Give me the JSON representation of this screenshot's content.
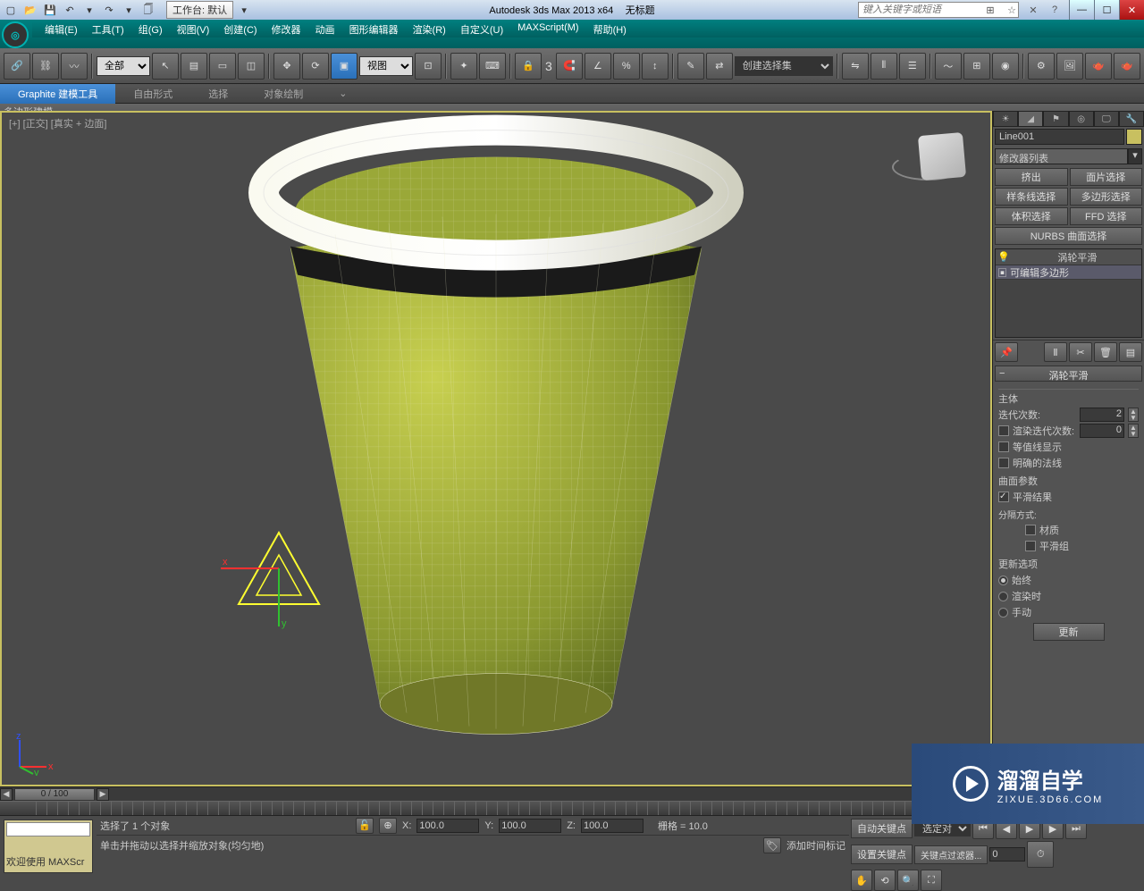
{
  "titlebar": {
    "workspace": "工作台: 默认",
    "app_title": "Autodesk 3ds Max  2013 x64",
    "doc_title": "无标题",
    "search_placeholder": "键入关键字或短语"
  },
  "menu": {
    "items": [
      "编辑(E)",
      "工具(T)",
      "组(G)",
      "视图(V)",
      "创建(C)",
      "修改器",
      "动画",
      "图形编辑器",
      "渲染(R)",
      "自定义(U)",
      "MAXScript(M)",
      "帮助(H)"
    ]
  },
  "toolbar": {
    "filter_dd": "全部",
    "view_dd": "视图",
    "three": "3",
    "named_sel": "创建选择集"
  },
  "ribbon": {
    "tabs": [
      "Graphite 建模工具",
      "自由形式",
      "选择",
      "对象绘制"
    ],
    "sub": "多边形建模"
  },
  "viewport": {
    "label": "[+] [正交] [真实 + 边面]",
    "axis_x": "x",
    "axis_y": "y",
    "axis_z": "z"
  },
  "right_panel": {
    "object_name": "Line001",
    "modifier_list_label": "修改器列表",
    "buttons": [
      "挤出",
      "面片选择",
      "样条线选择",
      "多边形选择",
      "体积选择",
      "FFD 选择"
    ],
    "nurbs_btn": "NURBS 曲面选择",
    "stack": {
      "top": "涡轮平滑",
      "item1": "可编辑多边形"
    },
    "rollout_title": "涡轮平滑",
    "main_group": "主体",
    "iterations_label": "迭代次数:",
    "iterations_val": "2",
    "render_iter_label": "渲染迭代次数:",
    "render_iter_val": "0",
    "isoline_label": "等值线显示",
    "explicit_normals": "明确的法线",
    "surface_params": "曲面参数",
    "smooth_result": "平滑结果",
    "separate_by": "分隔方式:",
    "material": "材质",
    "smooth_group": "平滑组",
    "update_options": "更新选项",
    "always": "始终",
    "on_render": "渲染时",
    "manual": "手动",
    "update_btn": "更新"
  },
  "timeline": {
    "slider": "0 / 100"
  },
  "status": {
    "welcome": "欢迎使用  MAXScr",
    "selection": "选择了 1 个对象",
    "hint": "单击并拖动以选择并缩放对象(均匀地)",
    "x_lbl": "X:",
    "x_val": "100.0",
    "y_lbl": "Y:",
    "y_val": "100.0",
    "z_lbl": "Z:",
    "z_val": "100.0",
    "grid": "栅格 = 10.0",
    "add_time_tag": "添加时间标记",
    "autokey": "自动关键点",
    "setkey": "设置关键点",
    "selected_dd": "选定对",
    "keyfilter": "关键点过滤器...",
    "frame": "0"
  },
  "watermark": {
    "main": "溜溜自学",
    "sub": "ZIXUE.3D66.COM"
  }
}
